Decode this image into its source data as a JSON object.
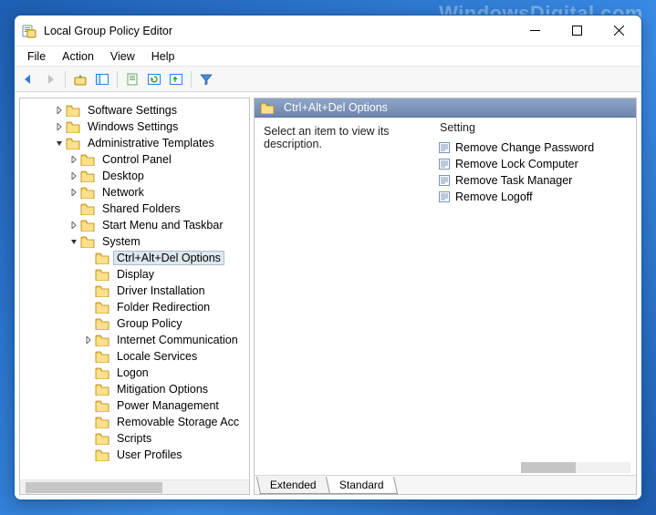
{
  "watermark": "WindowsDigital.com",
  "titlebar": {
    "title": "Local Group Policy Editor"
  },
  "menu": {
    "file": "File",
    "action": "Action",
    "view": "View",
    "help": "Help"
  },
  "tree": {
    "items": [
      {
        "label": "Software Settings",
        "indent": 2,
        "caret": "right"
      },
      {
        "label": "Windows Settings",
        "indent": 2,
        "caret": "right"
      },
      {
        "label": "Administrative Templates",
        "indent": 2,
        "caret": "down"
      },
      {
        "label": "Control Panel",
        "indent": 3,
        "caret": "right"
      },
      {
        "label": "Desktop",
        "indent": 3,
        "caret": "right"
      },
      {
        "label": "Network",
        "indent": 3,
        "caret": "right"
      },
      {
        "label": "Shared Folders",
        "indent": 3,
        "caret": "none"
      },
      {
        "label": "Start Menu and Taskbar",
        "indent": 3,
        "caret": "right"
      },
      {
        "label": "System",
        "indent": 3,
        "caret": "down"
      },
      {
        "label": "Ctrl+Alt+Del Options",
        "indent": 4,
        "caret": "none",
        "selected": true
      },
      {
        "label": "Display",
        "indent": 4,
        "caret": "none"
      },
      {
        "label": "Driver Installation",
        "indent": 4,
        "caret": "none"
      },
      {
        "label": "Folder Redirection",
        "indent": 4,
        "caret": "none"
      },
      {
        "label": "Group Policy",
        "indent": 4,
        "caret": "none"
      },
      {
        "label": "Internet Communication",
        "indent": 4,
        "caret": "right"
      },
      {
        "label": "Locale Services",
        "indent": 4,
        "caret": "none"
      },
      {
        "label": "Logon",
        "indent": 4,
        "caret": "none"
      },
      {
        "label": "Mitigation Options",
        "indent": 4,
        "caret": "none"
      },
      {
        "label": "Power Management",
        "indent": 4,
        "caret": "none"
      },
      {
        "label": "Removable Storage Acc",
        "indent": 4,
        "caret": "none"
      },
      {
        "label": "Scripts",
        "indent": 4,
        "caret": "none"
      },
      {
        "label": "User Profiles",
        "indent": 4,
        "caret": "none"
      }
    ]
  },
  "details": {
    "header": "Ctrl+Alt+Del Options",
    "placeholder": "Select an item to view its description.",
    "column": "Setting",
    "settings": [
      "Remove Change Password",
      "Remove Lock Computer",
      "Remove Task Manager",
      "Remove Logoff"
    ]
  },
  "tabs": {
    "extended": "Extended",
    "standard": "Standard"
  }
}
